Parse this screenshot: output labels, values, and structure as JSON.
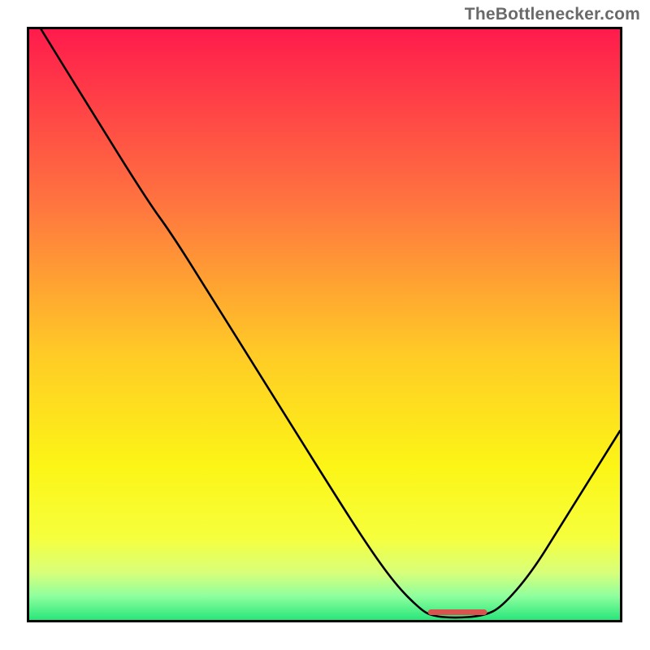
{
  "watermark": "TheBottlenecker.com",
  "chart_data": {
    "type": "line",
    "title": "",
    "xlabel": "",
    "ylabel": "",
    "xlim": [
      0,
      100
    ],
    "ylim": [
      0,
      100
    ],
    "curve_points": [
      {
        "x": 2.0,
        "y": 100.0
      },
      {
        "x": 10.0,
        "y": 87.0
      },
      {
        "x": 20.0,
        "y": 71.0
      },
      {
        "x": 24.0,
        "y": 65.5
      },
      {
        "x": 30.0,
        "y": 56.0
      },
      {
        "x": 40.0,
        "y": 40.0
      },
      {
        "x": 50.0,
        "y": 24.0
      },
      {
        "x": 57.0,
        "y": 13.0
      },
      {
        "x": 62.0,
        "y": 6.0
      },
      {
        "x": 66.0,
        "y": 2.0
      },
      {
        "x": 68.0,
        "y": 0.7
      },
      {
        "x": 72.0,
        "y": 0.3
      },
      {
        "x": 77.0,
        "y": 0.7
      },
      {
        "x": 80.0,
        "y": 2.2
      },
      {
        "x": 85.0,
        "y": 8.0
      },
      {
        "x": 90.0,
        "y": 16.0
      },
      {
        "x": 95.0,
        "y": 24.0
      },
      {
        "x": 100.0,
        "y": 32.0
      }
    ],
    "marker_segment": {
      "x_start": 67.5,
      "x_end": 77.5,
      "y": 1.3
    },
    "gradient_stops": [
      {
        "offset": 0.0,
        "color": "#ff1b4c"
      },
      {
        "offset": 0.3,
        "color": "#ff763f"
      },
      {
        "offset": 0.55,
        "color": "#ffcb26"
      },
      {
        "offset": 0.74,
        "color": "#fcf516"
      },
      {
        "offset": 0.86,
        "color": "#f6ff3c"
      },
      {
        "offset": 0.92,
        "color": "#d8ff7a"
      },
      {
        "offset": 0.96,
        "color": "#8eff9e"
      },
      {
        "offset": 1.0,
        "color": "#28e67a"
      }
    ]
  }
}
